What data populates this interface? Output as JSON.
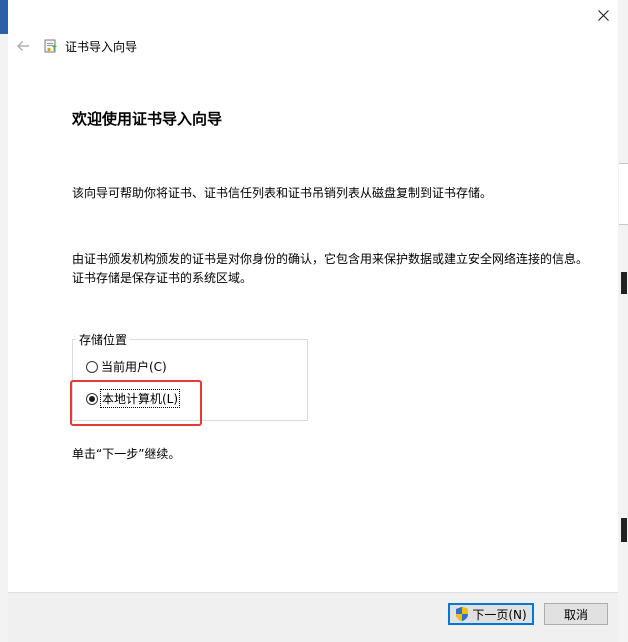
{
  "window": {
    "title": "证书导入向导"
  },
  "page": {
    "heading": "欢迎使用证书导入向导",
    "description1": "该向导可帮助你将证书、证书信任列表和证书吊销列表从磁盘复制到证书存储。",
    "description2": "由证书颁发机构颁发的证书是对你身份的确认，它包含用来保护数据或建立安全网络连接的信息。证书存储是保存证书的系统区域。",
    "hint": "单击“下一步”继续。"
  },
  "store_location": {
    "legend": "存储位置",
    "options": [
      {
        "label": "当前用户(C)",
        "checked": false
      },
      {
        "label": "本地计算机(L)",
        "checked": true
      }
    ]
  },
  "footer": {
    "next_label": "下一页(N)",
    "cancel_label": "取消"
  },
  "colors": {
    "highlight": "#e53935",
    "focus_button": "#0078d7",
    "footer_bg": "#f0f0f0"
  },
  "icons": {
    "close": "close-icon",
    "back": "back-arrow-icon",
    "wizard": "certificate-wizard-icon",
    "shield": "uac-shield-icon"
  }
}
